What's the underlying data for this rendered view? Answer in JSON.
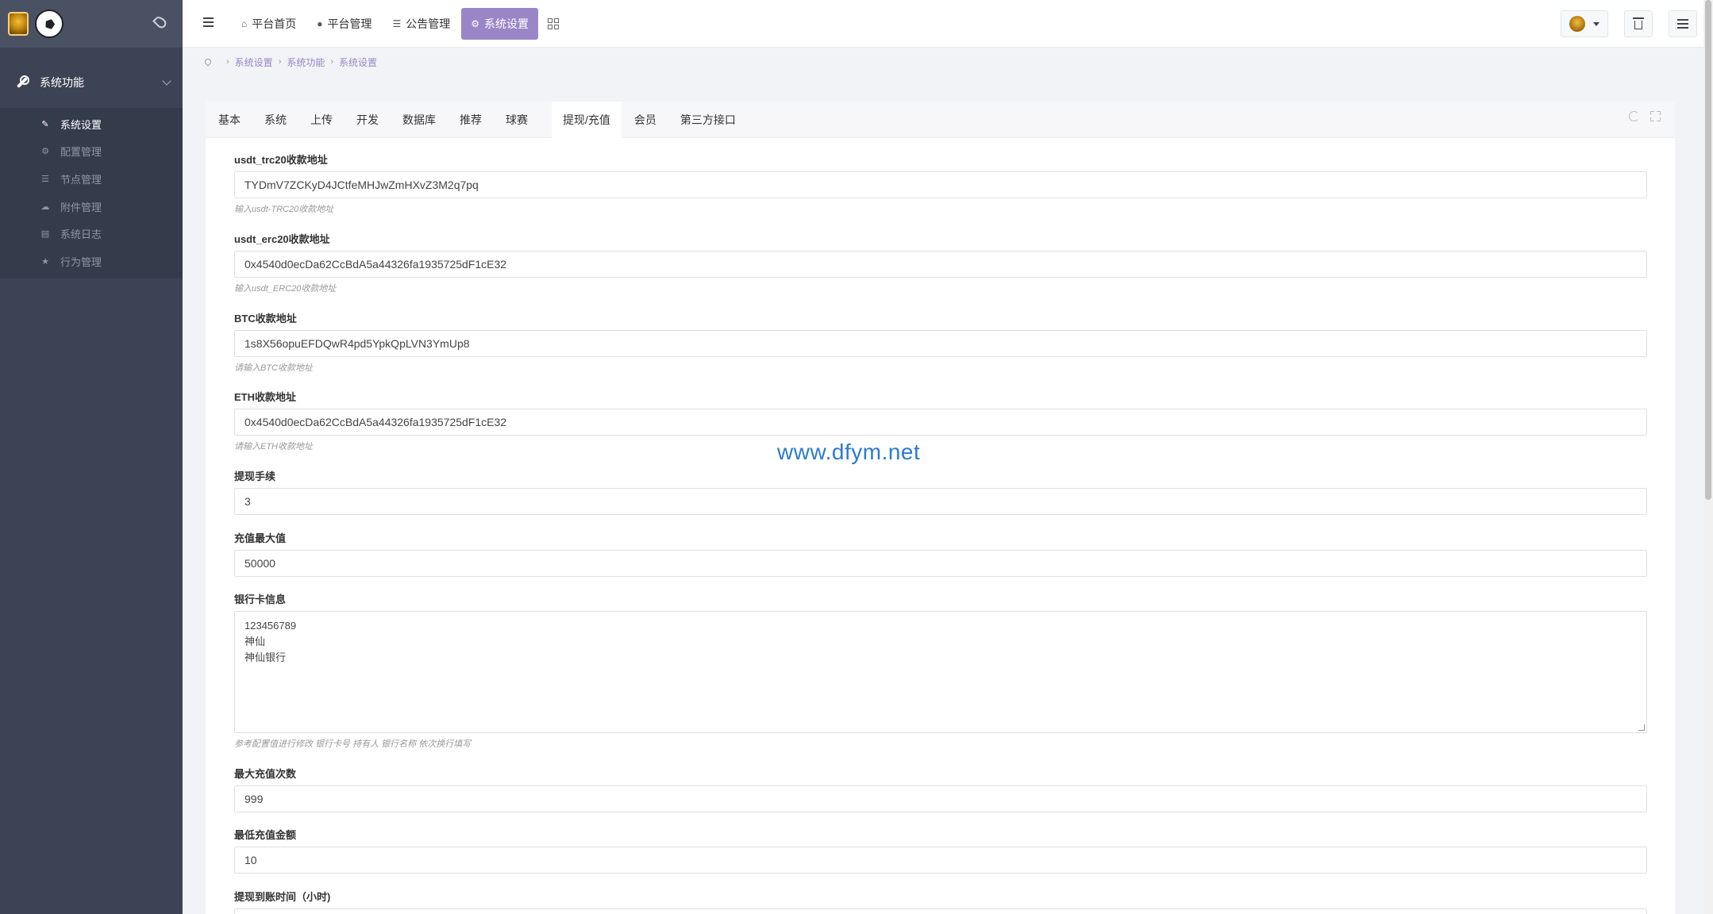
{
  "sidebar": {
    "group_label": "系统功能",
    "items": [
      {
        "label": "系统设置",
        "icon": "wrench-icon"
      },
      {
        "label": "配置管理",
        "icon": "cogs-icon"
      },
      {
        "label": "节点管理",
        "icon": "list-icon"
      },
      {
        "label": "附件管理",
        "icon": "cloud-icon"
      },
      {
        "label": "系统日志",
        "icon": "book-icon"
      },
      {
        "label": "行为管理",
        "icon": "star-icon"
      }
    ]
  },
  "header": {
    "nav": [
      {
        "label": "平台首页",
        "icon": "home-icon"
      },
      {
        "label": "平台管理",
        "icon": "user-icon"
      },
      {
        "label": "公告管理",
        "icon": "list-icon"
      },
      {
        "label": "系统设置",
        "icon": "gear-icon"
      }
    ]
  },
  "breadcrumb": [
    "系统设置",
    "系统功能",
    "系统设置"
  ],
  "tabs": [
    "基本",
    "系统",
    "上传",
    "开发",
    "数据库",
    "推荐",
    "球赛",
    "提现/充值",
    "会员",
    "第三方接口"
  ],
  "active_tab": "提现/充值",
  "form": {
    "usdt_trc20": {
      "label": "usdt_trc20收款地址",
      "value": "TYDmV7ZCKyD4JCtfeMHJwZmHXvZ3M2q7pq",
      "help": "输入usdt-TRC20收款地址"
    },
    "usdt_erc20": {
      "label": "usdt_erc20收款地址",
      "value": "0x4540d0ecDa62CcBdA5a44326fa1935725dF1cE32",
      "help": "输入usdt_ERC20收款地址"
    },
    "btc": {
      "label": "BTC收款地址",
      "value": "1s8X56opuEFDQwR4pd5YpkQpLVN3YmUp8",
      "help": "请输入BTC收款地址"
    },
    "eth": {
      "label": "ETH收款地址",
      "value": "0x4540d0ecDa62CcBdA5a44326fa1935725dF1cE32",
      "help": "请输入ETH收款地址"
    },
    "fee": {
      "label": "提现手续",
      "value": "3"
    },
    "max_recharge": {
      "label": "充值最大值",
      "value": "50000"
    },
    "bank": {
      "label": "银行卡信息",
      "lines": [
        "123456789",
        "神仙",
        "神仙银行"
      ],
      "help": "参考配置值进行修改 银行卡号 持有人 银行名称 依次换行填写"
    },
    "max_times": {
      "label": "最大充值次数",
      "value": "999"
    },
    "min_amount": {
      "label": "最低充值金额",
      "value": "10"
    },
    "arrival_time": {
      "label": "提现到账时间（小时)"
    }
  },
  "watermark": "www.dfym.net",
  "colors": {
    "accent": "#9a86c7",
    "sidebar": "#3c4354",
    "watermark": "#2a7bd0"
  }
}
